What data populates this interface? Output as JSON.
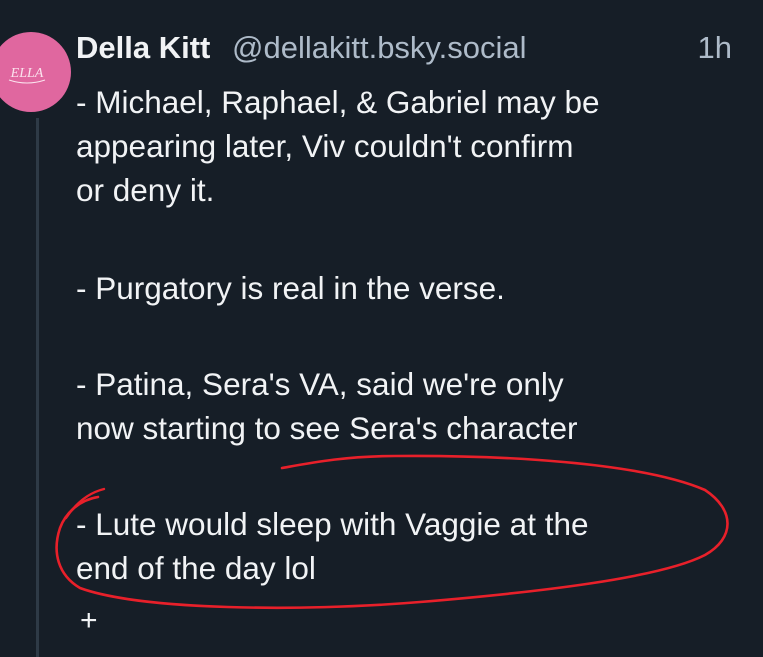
{
  "post": {
    "author": {
      "display_name": "Della Kitt",
      "handle": "@dellakitt.bsky.social",
      "avatar_text": "ELLA"
    },
    "timestamp": "1h",
    "lines": [
      "- Michael, Raphael, & Gabriel may be",
      "appearing later, Viv couldn't confirm",
      "or deny it.",
      "- Purgatory is real in the verse.",
      "- Patina, Sera's VA, said we're only",
      "now starting to see Sera's character",
      "- Lute would sleep with Vaggie at the",
      "end of the day lol"
    ],
    "more_indicator": "+"
  },
  "colors": {
    "background": "#161e27",
    "text": "#f1f3f5",
    "secondary_text": "#aebbc9",
    "avatar_bg": "#e0679f",
    "annotation": "#e8202a"
  },
  "annotation": {
    "shape": "hand-drawn-loop",
    "color": "#e8202a"
  }
}
